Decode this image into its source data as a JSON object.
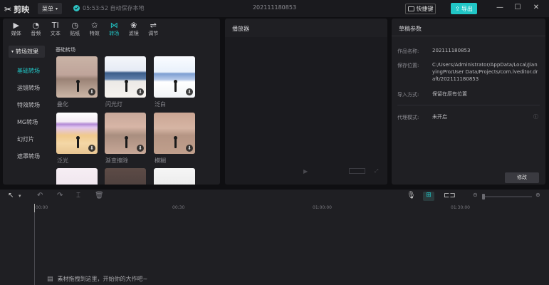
{
  "titlebar": {
    "app_name": "剪映",
    "menu_label": "菜单",
    "save_status": "05:53:52 自动保存本地",
    "project_title": "202111180853",
    "shortcut_label": "快捷键",
    "export_label": "导出"
  },
  "toolbar": {
    "tabs": [
      {
        "label": "媒体",
        "icon": "media-icon"
      },
      {
        "label": "音频",
        "icon": "audio-icon"
      },
      {
        "label": "文本",
        "icon": "text-icon"
      },
      {
        "label": "贴纸",
        "icon": "sticker-icon"
      },
      {
        "label": "特效",
        "icon": "effects-icon"
      },
      {
        "label": "转场",
        "icon": "transition-icon"
      },
      {
        "label": "滤镜",
        "icon": "filter-icon"
      },
      {
        "label": "调节",
        "icon": "adjust-icon"
      }
    ],
    "active_tab": "转场"
  },
  "left_nav": {
    "group_label": "转场效果",
    "items": [
      "基础转场",
      "运镜转场",
      "特效转场",
      "MG转场",
      "幻灯片",
      "遮罩转场"
    ],
    "active": "基础转场"
  },
  "transitions": {
    "section_title": "基础转场",
    "items": [
      {
        "label": "叠化"
      },
      {
        "label": "闪光灯"
      },
      {
        "label": "泛白"
      },
      {
        "label": "泛光"
      },
      {
        "label": "渐变擦除"
      },
      {
        "label": "模糊"
      }
    ]
  },
  "player": {
    "title": "播放器"
  },
  "draft": {
    "title": "草稿参数",
    "fields": [
      {
        "label": "作品名称:",
        "value": "202111180853"
      },
      {
        "label": "保存位置:",
        "value": "C:/Users/Administrator/AppData/Local/JianyingPro/User Data/Projects/com.lveditor.draft/202111180853"
      },
      {
        "label": "导入方式:",
        "value": "保留在原有位置"
      },
      {
        "label": "代理模式:",
        "value": "未开启"
      }
    ],
    "edit_label": "修改"
  },
  "timeline": {
    "ticks": [
      "00:00",
      "00:30",
      "01:00:00",
      "01:30:00"
    ],
    "hint": "素材拖拽到这里，开始你的大作吧~"
  },
  "colors": {
    "accent": "#21c6c6",
    "panel": "#1f1f23",
    "background": "#0f0f12"
  }
}
